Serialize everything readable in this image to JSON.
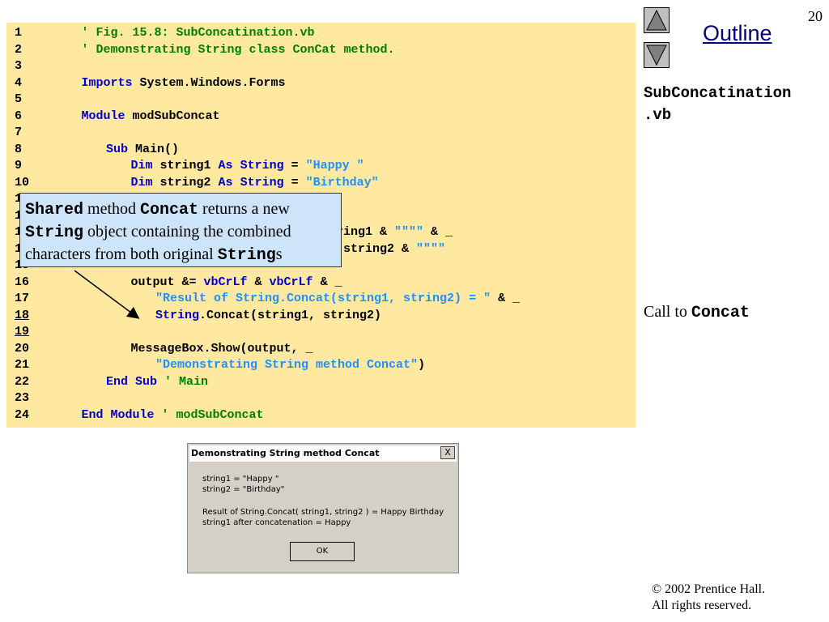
{
  "slide": {
    "page_number": "20",
    "nav_up_icon": "triangle-up-icon",
    "nav_down_icon": "triangle-down-icon",
    "outline_label": "Outline",
    "filename_line1": "SubConcatination",
    "filename_line2": ".vb",
    "side_note_text": "Call to ",
    "side_note_code": "Concat",
    "copyright_line1": "© 2002 Prentice Hall.",
    "copyright_line2": "All rights reserved."
  },
  "code": {
    "lines": [
      {
        "num": "1",
        "tokens": [
          {
            "t": "' Fig. 15.8: SubConcatination.vb",
            "c": "cm"
          }
        ],
        "indent": 1
      },
      {
        "num": "2",
        "tokens": [
          {
            "t": "' Demonstrating String class ConCat method.",
            "c": "cm"
          }
        ],
        "indent": 1
      },
      {
        "num": "3",
        "tokens": [],
        "indent": 0
      },
      {
        "num": "4",
        "tokens": [
          {
            "t": "Imports",
            "c": "kw"
          },
          {
            "t": " System.Windows.Forms",
            "c": "pl"
          }
        ],
        "indent": 1
      },
      {
        "num": "5",
        "tokens": [],
        "indent": 0
      },
      {
        "num": "6",
        "tokens": [
          {
            "t": "Module",
            "c": "kw"
          },
          {
            "t": " modSubConcat",
            "c": "pl"
          }
        ],
        "indent": 1
      },
      {
        "num": "7",
        "tokens": [],
        "indent": 0
      },
      {
        "num": "8",
        "tokens": [
          {
            "t": "Sub",
            "c": "kw"
          },
          {
            "t": " Main()",
            "c": "pl"
          }
        ],
        "indent": 2
      },
      {
        "num": "9",
        "tokens": [
          {
            "t": "Dim",
            "c": "kw"
          },
          {
            "t": " string1 ",
            "c": "pl"
          },
          {
            "t": "As",
            "c": "kw"
          },
          {
            "t": " ",
            "c": "pl"
          },
          {
            "t": "String",
            "c": "kw"
          },
          {
            "t": " = ",
            "c": "pl"
          },
          {
            "t": "\"Happy \"",
            "c": "st"
          }
        ],
        "indent": 3
      },
      {
        "num": "10",
        "tokens": [
          {
            "t": "Dim",
            "c": "kw"
          },
          {
            "t": " string2 ",
            "c": "pl"
          },
          {
            "t": "As",
            "c": "kw"
          },
          {
            "t": " ",
            "c": "pl"
          },
          {
            "t": "String",
            "c": "kw"
          },
          {
            "t": " = ",
            "c": "pl"
          },
          {
            "t": "\"Birthday\"",
            "c": "st"
          }
        ],
        "indent": 3
      },
      {
        "num": "11",
        "tokens": [],
        "indent": 0
      },
      {
        "num": "12",
        "tokens": [],
        "indent": 0
      },
      {
        "num": "13",
        "tokens": [
          {
            "t": "ring1 & ",
            "c": "pl"
          },
          {
            "t": "\"\"\"\"",
            "c": "st"
          },
          {
            "t": " & _",
            "c": "pl"
          }
        ],
        "indent": 0,
        "offset": 415
      },
      {
        "num": "14",
        "tokens": [
          {
            "t": "string2 & ",
            "c": "pl"
          },
          {
            "t": "\"\"\"\"",
            "c": "st"
          }
        ],
        "indent": 0,
        "offset": 424
      },
      {
        "num": "15",
        "tokens": [],
        "indent": 0
      },
      {
        "num": "16",
        "tokens": [
          {
            "t": "output &= ",
            "c": "pl"
          },
          {
            "t": "vbCrLf",
            "c": "kw"
          },
          {
            "t": " & ",
            "c": "pl"
          },
          {
            "t": "vbCrLf",
            "c": "kw"
          },
          {
            "t": " & _",
            "c": "pl"
          }
        ],
        "indent": 3
      },
      {
        "num": "17",
        "tokens": [
          {
            "t": "\"Result of String.Concat(string1, string2) = \"",
            "c": "st"
          },
          {
            "t": " & _",
            "c": "pl"
          }
        ],
        "indent": 4
      },
      {
        "num": "18",
        "tokens": [
          {
            "t": "String",
            "c": "kw"
          },
          {
            "t": ".Concat(string1, string2)",
            "c": "pl"
          }
        ],
        "indent": 4,
        "underline": true
      },
      {
        "num": "19",
        "tokens": [],
        "indent": 0,
        "underline": true
      },
      {
        "num": "20",
        "tokens": [
          {
            "t": "MessageBox.Show(output, _",
            "c": "pl"
          }
        ],
        "indent": 3
      },
      {
        "num": "21",
        "tokens": [
          {
            "t": "\"Demonstrating String method Concat\"",
            "c": "st"
          },
          {
            "t": ")",
            "c": "pl"
          }
        ],
        "indent": 4
      },
      {
        "num": "22",
        "tokens": [
          {
            "t": "End Sub",
            "c": "kw"
          },
          {
            "t": " ",
            "c": "pl"
          },
          {
            "t": "' Main",
            "c": "cm"
          }
        ],
        "indent": 2
      },
      {
        "num": "23",
        "tokens": [],
        "indent": 0
      },
      {
        "num": "24",
        "tokens": [
          {
            "t": "End Module",
            "c": "kw"
          },
          {
            "t": " ",
            "c": "pl"
          },
          {
            "t": "' modSubConcat",
            "c": "cm"
          }
        ],
        "indent": 1
      }
    ]
  },
  "callout": {
    "part1_code": "Shared",
    "part2": " method ",
    "part3_code": "Concat",
    "part4": " returns a new ",
    "part5_code": "String",
    "part6": " object containing the combined characters from both original ",
    "part7_code": "String",
    "part8": "s"
  },
  "messagebox": {
    "title": "Demonstrating String method Concat",
    "close_label": "X",
    "line1": "string1 = \"Happy \"",
    "line2": "string2 = \"Birthday\"",
    "line3": "Result of String.Concat( string1, string2 ) = Happy Birthday",
    "line4": "string1 after concatenation = Happy",
    "ok_label": "OK"
  }
}
